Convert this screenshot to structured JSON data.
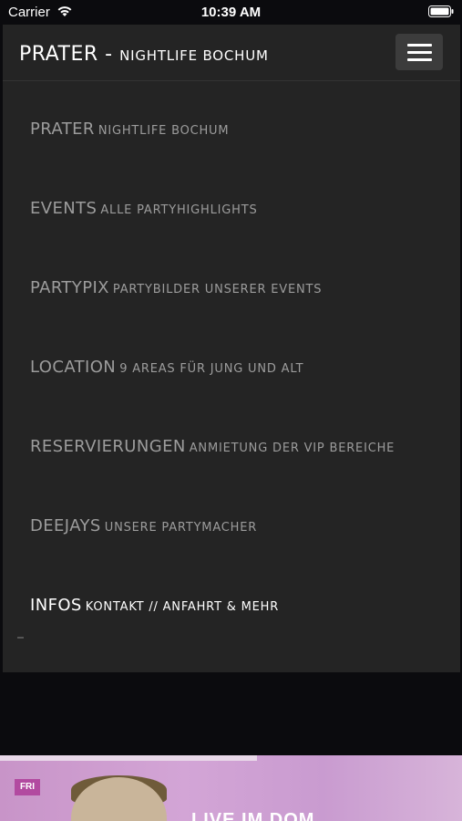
{
  "status_bar": {
    "carrier": "Carrier",
    "time": "10:39 AM"
  },
  "brand": {
    "name": "PRATER",
    "separator": " - ",
    "tagline": "NIGHTLIFE BOCHUM"
  },
  "menu": {
    "items": [
      {
        "title": "PRATER",
        "subtitle": "NIGHTLIFE BOCHUM",
        "active": false
      },
      {
        "title": "EVENTS",
        "subtitle": "ALLE PARTYHIGHLIGHTS",
        "active": false
      },
      {
        "title": "PARTYPIX",
        "subtitle": "PARTYBILDER UNSERER EVENTS",
        "active": false
      },
      {
        "title": "LOCATION",
        "subtitle": "9 AREAS FÜR JUNG UND ALT",
        "active": false
      },
      {
        "title": "RESERVIERUNGEN",
        "subtitle": "ANMIETUNG DER VIP BEREICHE",
        "active": false
      },
      {
        "title": "DEEJAYS",
        "subtitle": "UNSERE PARTYMACHER",
        "active": false
      },
      {
        "title": "INFOS",
        "subtitle": "KONTAKT // ANFAHRT & MEHR",
        "active": true
      }
    ]
  },
  "hero": {
    "badge": "FRI",
    "headline": "LIVE IM DOM"
  },
  "colors": {
    "navbar_bg": "#242424",
    "page_bg": "#0b0b0e",
    "menu_text": "#9c9c9c",
    "menu_active": "#ffffff",
    "toggle_bg": "#3c3c3c"
  }
}
